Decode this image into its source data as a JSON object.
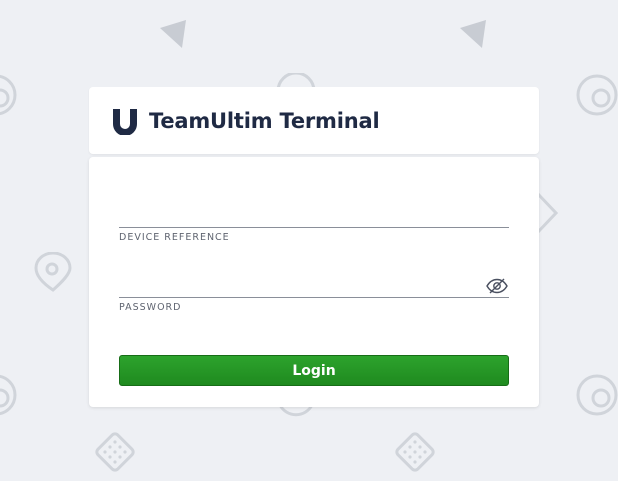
{
  "app": {
    "title": "TeamUltim Terminal"
  },
  "form": {
    "device_reference": {
      "label": "DEVICE REFERENCE",
      "value": ""
    },
    "password": {
      "label": "PASSWORD",
      "value": ""
    },
    "login_label": "Login"
  },
  "icons": {
    "logo": "teamultim-logo-icon",
    "password_toggle": "eye-slash-icon"
  },
  "colors": {
    "background": "#eef0f4",
    "title": "#1f2a44",
    "login_button": "#22962a"
  }
}
